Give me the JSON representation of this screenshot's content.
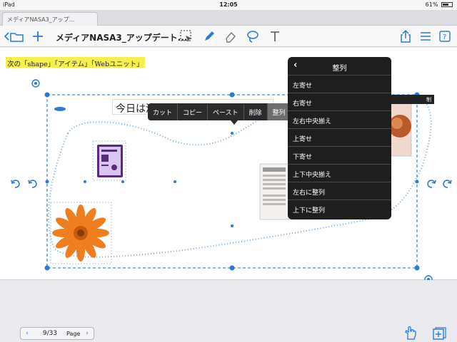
{
  "status_bar": {
    "device": "iPad",
    "time": "12:05",
    "battery": "61%"
  },
  "tab": {
    "label": "メディアNASA3_アップ..."
  },
  "toolbar": {
    "doc_title": "メディアNASA3_アップデート..."
  },
  "page": {
    "highlight_text": "次の「shape」「アイテム」「Webユニット」",
    "heading_text": "今日は清々しい陽気でした。"
  },
  "context_menu": {
    "items": [
      "カット",
      "コピー",
      "ペースト",
      "削除",
      "整列"
    ],
    "more": "›"
  },
  "align_popover": {
    "back": "‹",
    "title": "整列",
    "items": [
      "左寄せ",
      "右寄せ",
      "左右中央揃え",
      "上寄せ",
      "下寄せ",
      "上下中央揃え",
      "左右に整列",
      "上下に整列"
    ]
  },
  "behind_label": "制",
  "pager": {
    "prev": "‹",
    "page": "9/33",
    "label": "Page",
    "next": "›"
  },
  "colors": {
    "accent": "#2a7ad6",
    "selection": "#3a8ee6",
    "highlight": "#f5f04b",
    "menu_bg": "#1e1e1e"
  }
}
